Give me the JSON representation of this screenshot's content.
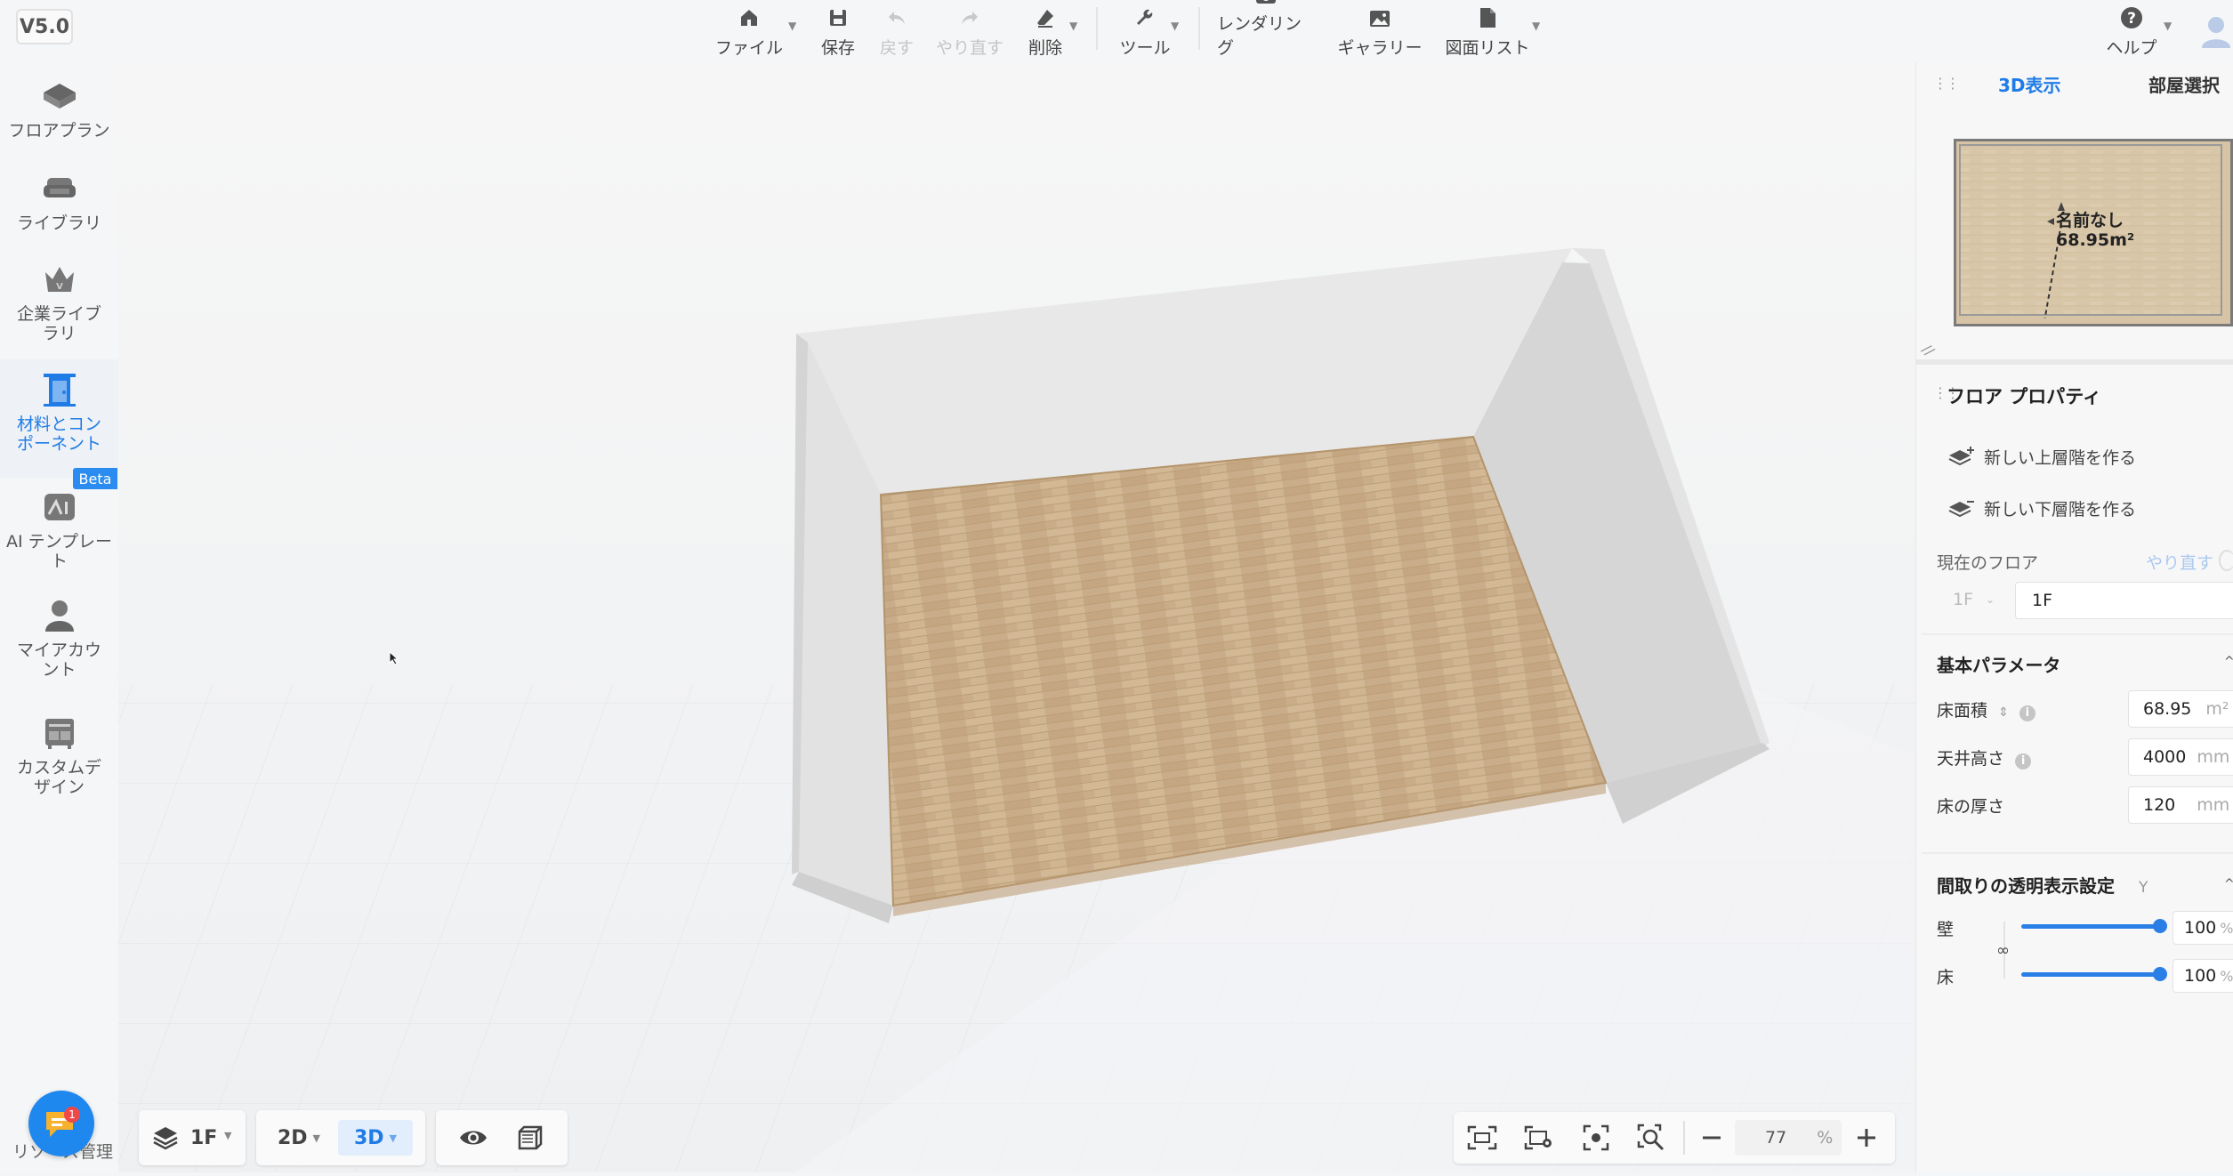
{
  "app": {
    "version": "V5.0"
  },
  "toolbar": {
    "file": "ファイル",
    "save": "保存",
    "undo": "戻す",
    "redo": "やり直す",
    "delete": "削除",
    "tools": "ツール",
    "rendering": "レンダリング",
    "gallery": "ギャラリー",
    "drawing_list": "図面リスト",
    "help": "ヘルプ"
  },
  "sidebar": {
    "items": [
      {
        "label": "フロアプラン",
        "icon": "floorplan-icon"
      },
      {
        "label": "ライブラリ",
        "icon": "sofa-icon"
      },
      {
        "label": "企業ライブラリ",
        "icon": "crown-icon"
      },
      {
        "label": "材料とコンポーネント",
        "icon": "door-icon"
      },
      {
        "label": "AI テンプレート",
        "icon": "ai-template-icon"
      },
      {
        "label": "マイアカウント",
        "icon": "user-icon"
      },
      {
        "label": "カスタムデザイン",
        "icon": "cabinet-icon"
      }
    ],
    "beta_badge": "Beta",
    "bottom_text": "リソース管理",
    "notification_count": "1"
  },
  "right_panel": {
    "tabs": [
      "3D表示",
      "部屋選択"
    ],
    "active_tab": "3D表示",
    "minimap": {
      "room_name": "名前なし",
      "area": "68.95m²"
    },
    "floor_props_title": "フロア プロパティ",
    "new_upper_floor": "新しい上層階を作る",
    "new_lower_floor": "新しい下層階を作る",
    "current_floor_label": "現在のフロア",
    "current_floor_redo": "やり直す",
    "floor_select": "1F",
    "floor_name": "1F",
    "basic_params_title": "基本パラメータ",
    "floor_area_label": "床面積",
    "floor_area_value": "68.95",
    "floor_area_unit": "m²",
    "ceiling_height_label": "天井高さ",
    "ceiling_height_value": "4000",
    "ceiling_height_unit": "mm",
    "floor_thickness_label": "床の厚さ",
    "floor_thickness_value": "120",
    "floor_thickness_unit": "mm",
    "transparency_title": "間取りの透明表示設定",
    "transparency_hotkey": "Y",
    "wall_label": "壁",
    "wall_value": "100",
    "floor_label": "床",
    "floor_value": "100",
    "percent": "%"
  },
  "bottom_left": {
    "floor": "1F",
    "view_2d": "2D",
    "view_3d": "3D"
  },
  "bottom_right": {
    "zoom": "77",
    "percent": "%"
  },
  "colors": {
    "accent": "#1f7ce6",
    "floor_wood": "#c8ab88",
    "wall": "#e6e6e6"
  }
}
